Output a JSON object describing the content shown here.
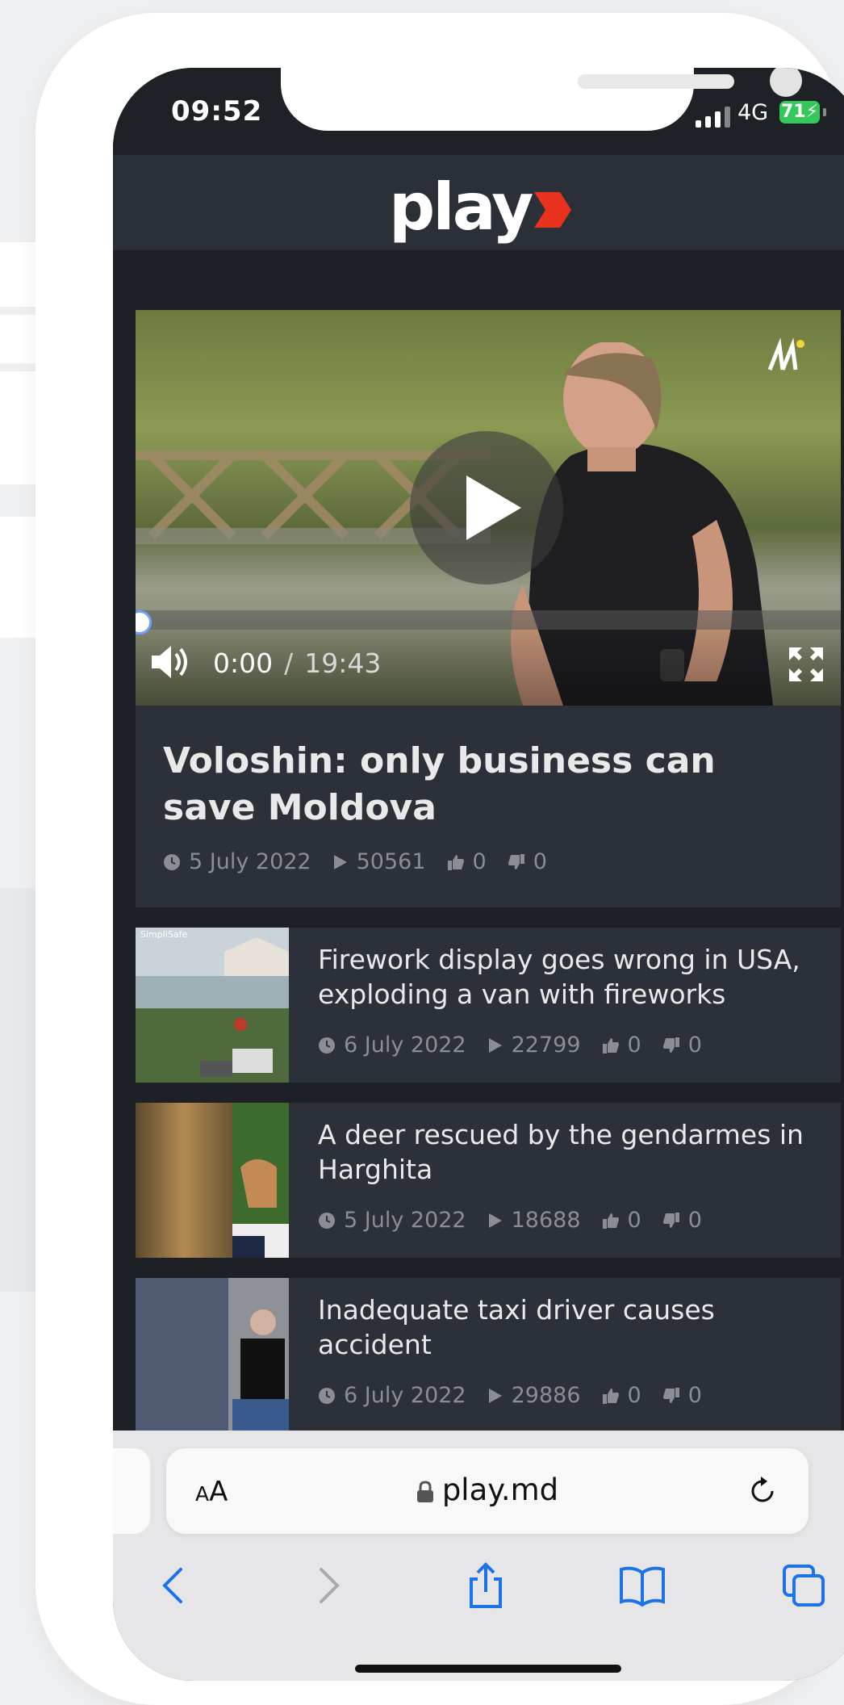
{
  "status": {
    "time": "09:52",
    "network": "4G",
    "battery": "71"
  },
  "site": {
    "logo": "play"
  },
  "video": {
    "current_time": "0:00",
    "separator": "/",
    "duration": "19:43"
  },
  "featured": {
    "title": "Voloshin: only business can save Moldova",
    "date": "5 July 2022",
    "views": "50561",
    "likes": "0",
    "dislikes": "0"
  },
  "articles": [
    {
      "title": "Firework display goes wrong in USA, exploding a van with fireworks",
      "date": "6 July 2022",
      "views": "22799",
      "likes": "0",
      "dislikes": "0",
      "thumb_label": "SimpliSafe"
    },
    {
      "title": "A deer rescued by the gendarmes in Harghita",
      "date": "5 July 2022",
      "views": "18688",
      "likes": "0",
      "dislikes": "0"
    },
    {
      "title": "Inadequate taxi driver causes accident",
      "date": "6 July 2022",
      "views": "29886",
      "likes": "0",
      "dislikes": "0"
    }
  ],
  "browser": {
    "text_size_small": "A",
    "text_size_large": "A",
    "url": "play.md"
  },
  "colors": {
    "accent": "#e8321e",
    "background": "#1d2126",
    "card": "#2c3038",
    "link_blue": "#1a73e8"
  }
}
